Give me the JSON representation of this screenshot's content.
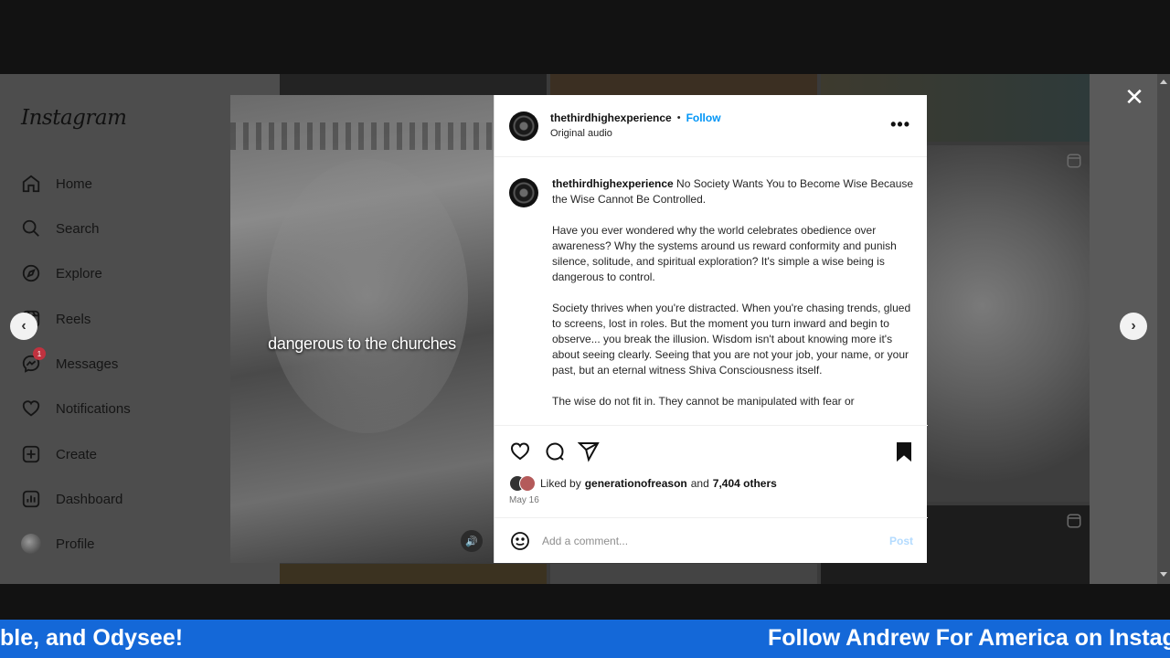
{
  "sidebar": {
    "logo": "Instagram",
    "items": [
      {
        "label": "Home",
        "icon": "home-icon"
      },
      {
        "label": "Search",
        "icon": "search-icon"
      },
      {
        "label": "Explore",
        "icon": "compass-icon"
      },
      {
        "label": "Reels",
        "icon": "reels-icon"
      },
      {
        "label": "Messages",
        "icon": "messenger-icon",
        "badge": "1"
      },
      {
        "label": "Notifications",
        "icon": "heart-icon"
      },
      {
        "label": "Create",
        "icon": "plus-square-icon"
      },
      {
        "label": "Dashboard",
        "icon": "dashboard-icon"
      },
      {
        "label": "Profile",
        "icon": "avatar"
      }
    ]
  },
  "video": {
    "caption": "dangerous to the churches"
  },
  "post": {
    "username": "thethirdhighexperience",
    "separator": "•",
    "follow_label": "Follow",
    "audio": "Original audio",
    "caption_user": "thethirdhighexperience",
    "caption_title": "No Society Wants You to Become Wise Because the Wise Cannot Be Controlled.",
    "paragraphs": [
      "Have you ever wondered why the world celebrates obedience over awareness? Why the systems around us reward conformity and punish silence, solitude, and spiritual exploration? It's simple a wise being is dangerous to control.",
      "Society thrives when you're distracted. When you're chasing trends, glued to screens, lost in roles. But the moment you turn inward and begin to observe... you break the illusion. Wisdom isn't about knowing more it's about seeing clearly. Seeing that you are not your job, your name, or your past, but an eternal witness Shiva Consciousness itself.",
      "The wise do not fit in. They cannot be manipulated with fear or"
    ],
    "liked_prefix": "Liked by",
    "liked_user": "generationofreason",
    "liked_and": "and",
    "liked_count": "7,404 others",
    "date": "May 16",
    "comment_placeholder": "Add a comment...",
    "post_label": "Post"
  },
  "ticker": {
    "left": "ble, and Odysee!",
    "right": "Follow Andrew For America on Instag"
  },
  "colors": {
    "accent": "#0095f6",
    "ticker_bg": "#1468d8",
    "badge": "#c0323f"
  }
}
